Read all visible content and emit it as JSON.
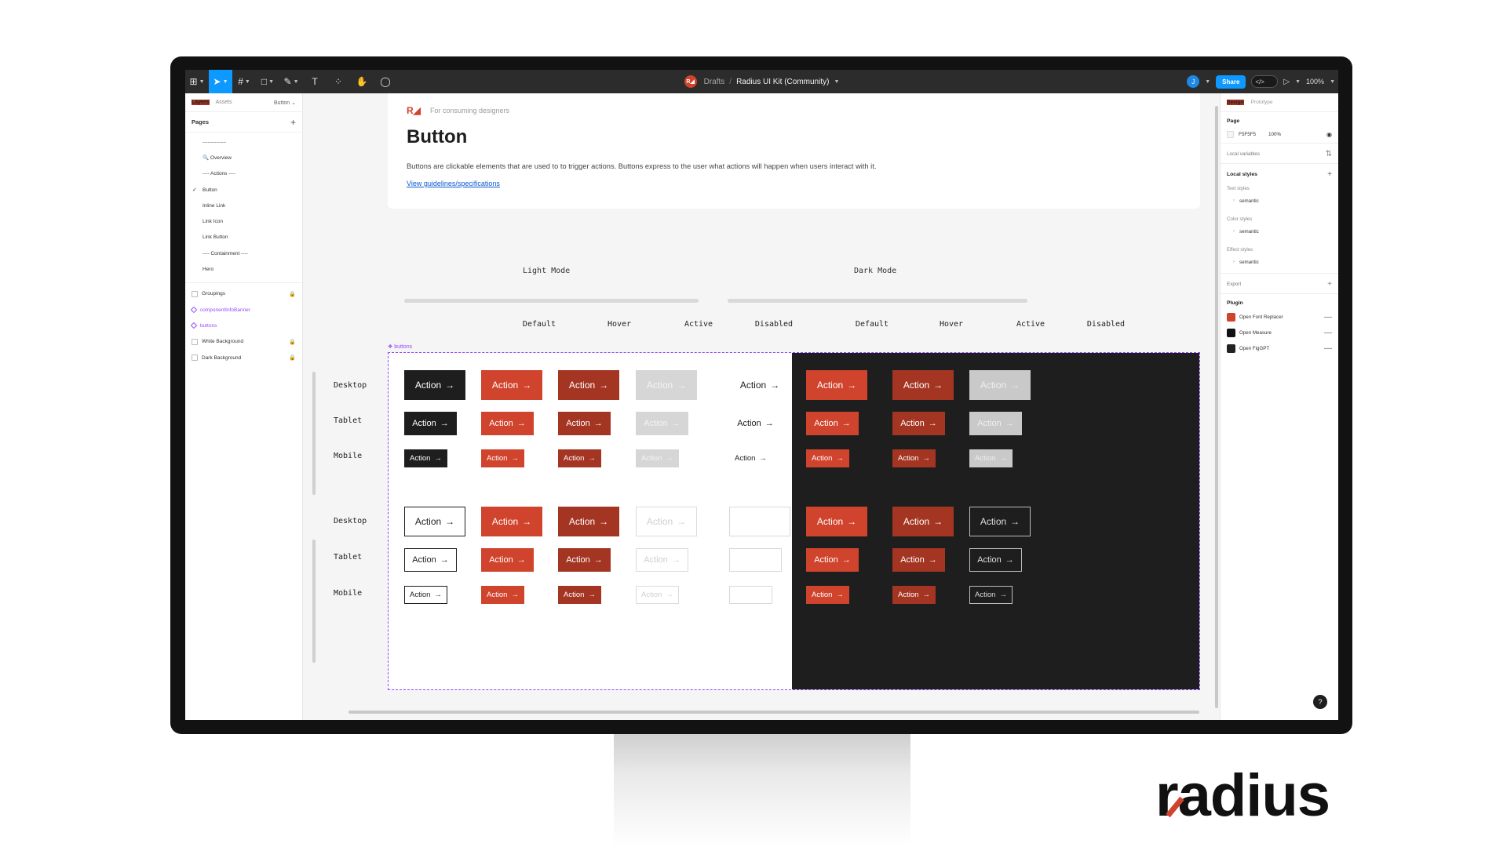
{
  "toolbar": {
    "tools": [
      {
        "icon": "figma-menu-icon",
        "glyph": "⊞",
        "active": false
      },
      {
        "icon": "move-tool-icon",
        "glyph": "➤",
        "active": true
      },
      {
        "icon": "frame-tool-icon",
        "glyph": "#",
        "active": false
      },
      {
        "icon": "shape-tool-icon",
        "glyph": "□",
        "active": false
      },
      {
        "icon": "pen-tool-icon",
        "glyph": "✎",
        "active": false
      },
      {
        "icon": "text-tool-icon",
        "glyph": "T",
        "active": false
      },
      {
        "icon": "resources-icon",
        "glyph": "⁘",
        "active": false
      },
      {
        "icon": "hand-tool-icon",
        "glyph": "✋",
        "active": false
      },
      {
        "icon": "comment-tool-icon",
        "glyph": "◯",
        "active": false
      }
    ],
    "file_icon_text": "R◢",
    "breadcrumb_folder": "Drafts",
    "breadcrumb_sep": "/",
    "file_name": "Radius UI Kit (Community)",
    "avatar_letter": "J",
    "share_label": "Share",
    "dev_mode_glyph": "</>",
    "play_glyph": "▷",
    "zoom_label": "100%"
  },
  "left_panel": {
    "tabs": [
      "Layers",
      "Assets"
    ],
    "page_selector": "Button ⌄",
    "pages_heading": "Pages",
    "pages": [
      {
        "label": "--------------",
        "current": false
      },
      {
        "label": "🔍 Overview",
        "current": false
      },
      {
        "label": "---- Actions ----",
        "current": false
      },
      {
        "label": "Button",
        "current": true
      },
      {
        "label": "Inline Link",
        "current": false
      },
      {
        "label": "Link Icon",
        "current": false
      },
      {
        "label": "Link Button",
        "current": false
      },
      {
        "label": "---- Containment ----",
        "current": false
      },
      {
        "label": "Hero",
        "current": false
      }
    ],
    "layers": [
      {
        "label": "Groupings",
        "locked": true,
        "component": false
      },
      {
        "label": "componentInfoBanner",
        "locked": false,
        "component": true
      },
      {
        "label": "buttons",
        "locked": false,
        "component": true
      },
      {
        "label": "White Background",
        "locked": true,
        "component": false
      },
      {
        "label": "Dark Background",
        "locked": true,
        "component": false
      }
    ]
  },
  "right_panel": {
    "tabs": [
      "Design",
      "Prototype"
    ],
    "page_heading": "Page",
    "page_color": "F5F5F5",
    "page_opacity": "100%",
    "local_variables": "Local variables",
    "local_styles": "Local styles",
    "text_styles": "Text styles",
    "color_styles": "Color styles",
    "effect_styles": "Effect styles",
    "semantic": "semantic",
    "export": "Export",
    "plugin_heading": "Plugin",
    "plugins": [
      {
        "label": "Open Font Replacer",
        "color": "#d0432c"
      },
      {
        "label": "Open Measure",
        "color": "#111111"
      },
      {
        "label": "Open FigGPT",
        "color": "#222222"
      }
    ],
    "help": "?"
  },
  "header_card": {
    "logo": "R◢",
    "tagline": "For consuming designers",
    "title": "Button",
    "description": "Buttons are clickable elements that are used to to trigger actions. Buttons express to the user what actions will happen when users interact with it.",
    "link": "View guidelines/specifications"
  },
  "modes": {
    "light": "Light Mode",
    "dark": "Dark Mode"
  },
  "columns": [
    "Default",
    "Hover",
    "Active",
    "Disabled"
  ],
  "rows": [
    "Desktop",
    "Tablet",
    "Mobile"
  ],
  "component_tag": "❖ buttons",
  "button_label": "Action",
  "button_arrow": "→",
  "colors": {
    "accent": "#d0432c",
    "accent_active": "#a43522",
    "dark_bg": "#1e1e1e",
    "canvas_bg": "#f5f5f5",
    "selection": "#9747ff",
    "toolbar": "#2c2c2c",
    "share_blue": "#0d99ff"
  },
  "brand_wordmark": "radius"
}
